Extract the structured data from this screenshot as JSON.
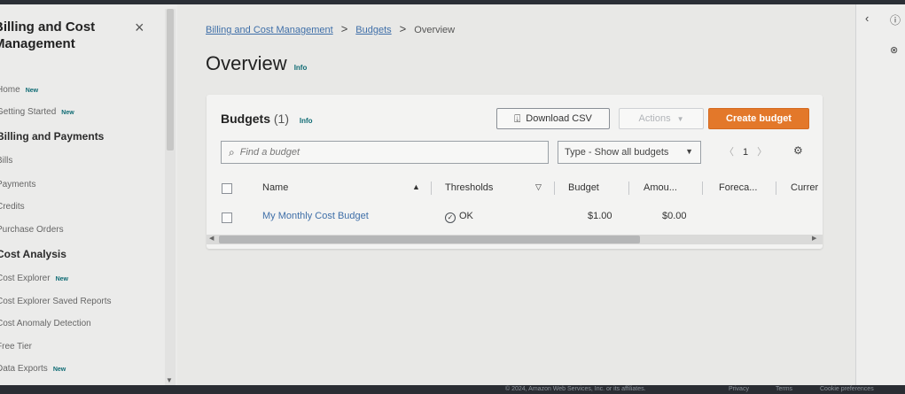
{
  "sidebar": {
    "title": "Billing and Cost Management",
    "close": "×",
    "items": [
      {
        "label": "Home",
        "badge": "New"
      },
      {
        "label": "Getting Started",
        "badge": "New"
      },
      {
        "label": "Billing and Payments",
        "section": true
      },
      {
        "label": "Bills"
      },
      {
        "label": "Payments"
      },
      {
        "label": "Credits"
      },
      {
        "label": "Purchase Orders"
      },
      {
        "label": "Cost Analysis",
        "section": true
      },
      {
        "label": "Cost Explorer",
        "badge": "New"
      },
      {
        "label": "Cost Explorer Saved Reports"
      },
      {
        "label": "Cost Anomaly Detection"
      },
      {
        "label": "Free Tier"
      },
      {
        "label": "Data Exports",
        "badge": "New"
      }
    ]
  },
  "breadcrumb": {
    "items": [
      "Billing and Cost Management",
      "Budgets",
      "Overview"
    ],
    "separator": ">"
  },
  "page": {
    "title": "Overview",
    "info": "Info"
  },
  "budgets": {
    "title": "Budgets",
    "count": "(1)",
    "info": "Info",
    "download_label": "Download CSV",
    "actions_label": "Actions",
    "create_label": "Create budget",
    "search_placeholder": "Find a budget",
    "filter_label": "Type - Show all budgets",
    "page_number": "1",
    "columns": [
      "Name",
      "Thresholds",
      "Budget",
      "Amou...",
      "Foreca...",
      "Currer"
    ],
    "rows": [
      {
        "name": "My Monthly Cost Budget",
        "thresholds": "OK",
        "budget": "$1.00",
        "amount": "$0.00",
        "forecast": "",
        "current": ""
      }
    ]
  },
  "footer": {
    "texts": [
      "© 2024, Amazon Web Services, Inc. or its affiliates.",
      "Privacy",
      "Terms",
      "Cookie preferences"
    ]
  },
  "colors": {
    "accent": "#e3782a",
    "link": "#3f6fa8",
    "info": "#0f6b74"
  }
}
